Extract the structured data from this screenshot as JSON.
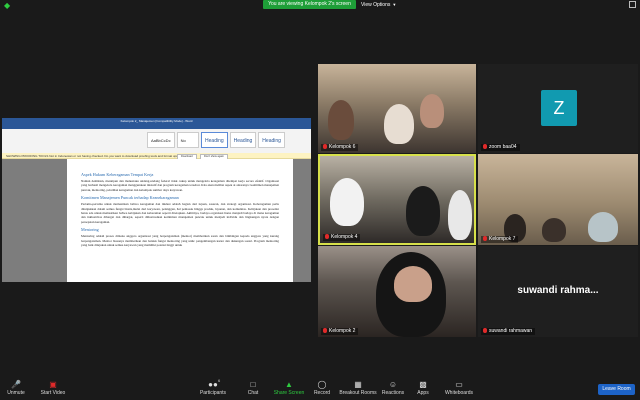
{
  "topbar": {
    "viewing_text": "You are viewing Kelompok 2's screen",
    "view_options": "View Options"
  },
  "shared_doc": {
    "title": "Kelompok 2_ Manajemen [Compatibility Mode] - Word",
    "tabs": [
      "File",
      "Home",
      "Insert",
      "Design",
      "Layout",
      "References",
      "Mailings",
      "Review",
      "View",
      "Help"
    ],
    "active_tab": "Home",
    "styles": [
      "AaBbCcDc",
      "No Spacing",
      "Heading 1",
      "Heading 2",
      "Heading 3"
    ],
    "notice": "SHOWING PROOFING TOOLS  Not in Indonesian or not having checked. Do you want to download proofing tools and format updates?",
    "notice_btn1": "Download",
    "notice_btn2": "Don't show again",
    "heading1": "Aspek Hukum Keberagaman Tempat Kerja",
    "para1": "Namun demikian, meskipun dan manusiaku undang-undang federal tidak cukup untuk mengelola keragaman ditempat kerja secara efektif. Organisasi yang berhasil mengelola keragaman menggunakan inisiatif dan program keragaman tersebut. Kita akan melihat aspek ai antaranya: komitmen manajemen puncak, mentoring, pelatihan keragaman dan kelompok sumber daya karyawan.",
    "heading2": "Komitmen Manajemen Puncak terhadap Keanekaragaman",
    "para2": "Pertama-pertama untuk memastikan bahwa keragaman dan inklusi adalah bagian dari tujuan, sasaran, dan strategi organisasi. Keberagaman perlu ditunjukkan dalam semua fungsi bisnis,mulai dari karyawan, pelanggan, hal pemasok hingga produk, layanan, dan komunitas. Kebijakan dan prosedur harus ada untuk memastikan bahwa kebijakan dan keberanian seperti ditetapkan. Akhirnya, budaya organisasi harus menjadi budaya di mana keragaman dan inklusivitas dihargai dan dihargai, seperti diilustrasikan komitmen manajemen puncak untuk menjadi individu dan lingkungan nyata dengan persepsian keragaman.",
    "heading3": "Mentoring",
    "para3": "Mentoring adalah proses dimana anggota organisasi yang berpengalaman (mentor) memberikan saran dan bimbingan kepada anggota yang kurang berpengalaman. Mentor biasanya memberikan dan bentuk fungsi mentoring yang unik: pengembangan karier dan dukungan sosial. Program mentoring yang baik ditujukan untuk semua karyawan yang memiliki potensi tinggi untuk"
  },
  "tiles": [
    {
      "name": "Kelompok 6",
      "muted": true
    },
    {
      "name": "zoom baa04",
      "muted": true,
      "avatar_letter": "Z"
    },
    {
      "name": "Kelompok 4",
      "muted": true,
      "active_speaker": true
    },
    {
      "name": "Kelompok 7",
      "muted": true
    },
    {
      "name": "Kelompok 2",
      "muted": true
    },
    {
      "name": "suwandi rahmawan",
      "muted": true,
      "display_name": "suwandi  rahma..."
    }
  ],
  "toolbar": {
    "unmute": "Unmute",
    "start_video": "Start Video",
    "participants": "Participants",
    "participants_count": "6",
    "chat": "Chat",
    "share_screen": "Share Screen",
    "record": "Record",
    "breakout_rooms": "Breakout Rooms",
    "reactions": "Reactions",
    "apps": "Apps",
    "whiteboards": "Whiteboards",
    "leave": "Leave Room"
  },
  "colors": {
    "accent_green": "#1e9e38",
    "leave_blue": "#1d63c7",
    "avatar_teal": "#119ab0",
    "speaker_highlight": "#d7e04a"
  }
}
